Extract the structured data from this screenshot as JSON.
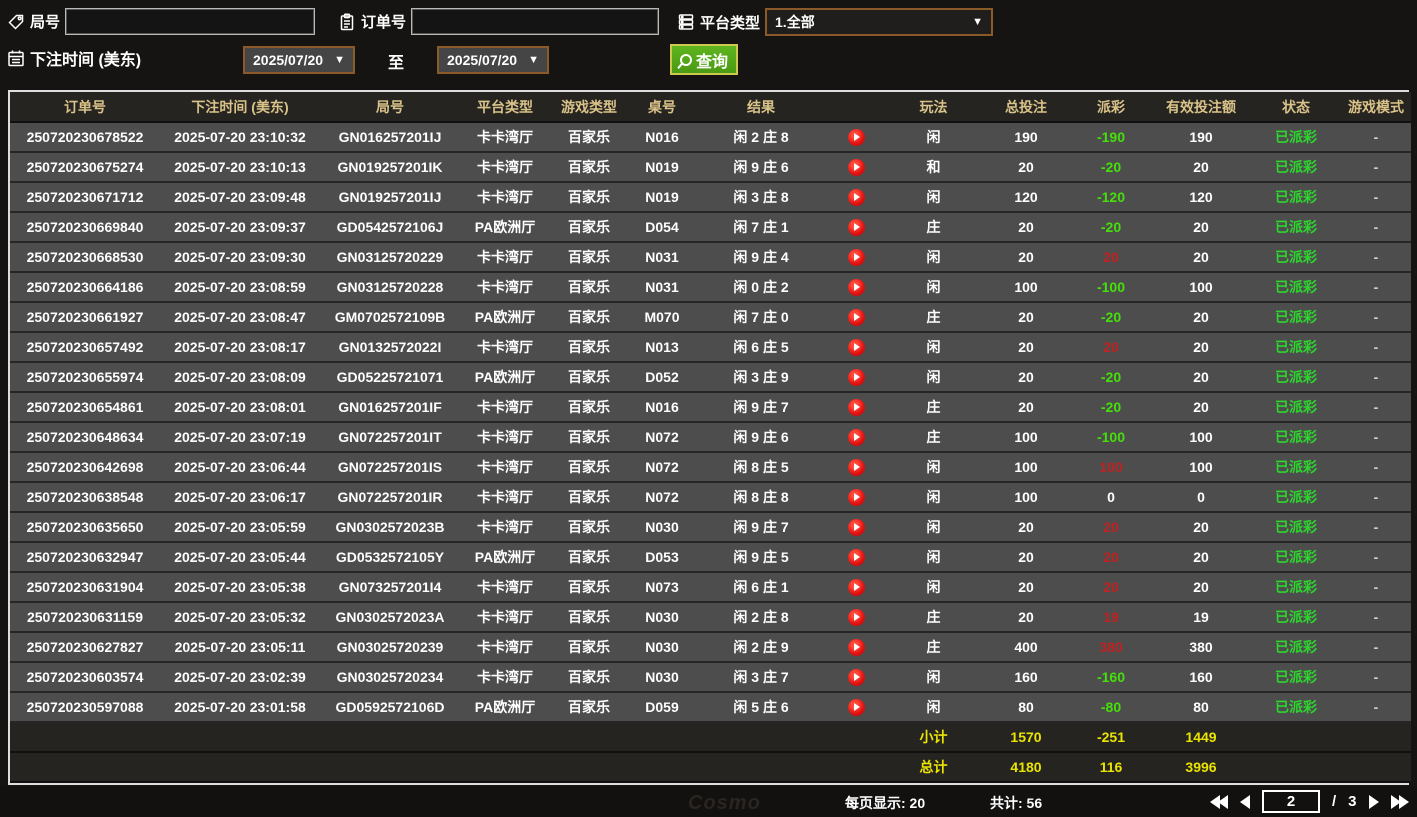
{
  "colors": {
    "header_text_gold": "#d9c389",
    "row_background": "#4d4d4d",
    "payout_loss_green": "#45e00a",
    "payout_win_red": "#bf2222",
    "status_paid_green": "#2dd52d",
    "totals_yellow": "#e9e400",
    "search_button_green": "#55a81c",
    "select_border_orange": "#8a5a28",
    "play_button_red": "#df1010"
  },
  "filters": {
    "round_label": "局号",
    "round_value": "",
    "order_label": "订单号",
    "order_value": "",
    "platform_label": "平台类型",
    "platform_value": "1.全部",
    "bet_time_label": "下注时间 (美东)",
    "date_from": "2025/07/20",
    "to_label": "至",
    "date_to": "2025/07/20",
    "search_label": "查询"
  },
  "table": {
    "headers": [
      {
        "key": "order-no",
        "label": "订单号"
      },
      {
        "key": "bet-time",
        "label": "下注时间 (美东)"
      },
      {
        "key": "round-no",
        "label": "局号"
      },
      {
        "key": "platform-type",
        "label": "平台类型"
      },
      {
        "key": "game-type",
        "label": "游戏类型"
      },
      {
        "key": "table-no",
        "label": "桌号"
      },
      {
        "key": "result",
        "label": "结果"
      },
      {
        "key": "video",
        "label": ""
      },
      {
        "key": "play-type",
        "label": "玩法"
      },
      {
        "key": "total-bet",
        "label": "总投注"
      },
      {
        "key": "payout",
        "label": "派彩"
      },
      {
        "key": "valid-bet",
        "label": "有效投注额"
      },
      {
        "key": "status",
        "label": "状态"
      },
      {
        "key": "game-mode",
        "label": "游戏模式"
      }
    ],
    "rows": [
      {
        "order": "250720230678522",
        "time": "2025-07-20 23:10:32",
        "round": "GN016257201IJ",
        "platform": "卡卡湾厅",
        "game": "百家乐",
        "table": "N016",
        "result": "闲 2 庄 8",
        "play": "闲",
        "bet": "190",
        "payout": "-190",
        "valid": "190",
        "status": "已派彩",
        "mode": "-"
      },
      {
        "order": "250720230675274",
        "time": "2025-07-20 23:10:13",
        "round": "GN019257201IK",
        "platform": "卡卡湾厅",
        "game": "百家乐",
        "table": "N019",
        "result": "闲 9 庄 6",
        "play": "和",
        "bet": "20",
        "payout": "-20",
        "valid": "20",
        "status": "已派彩",
        "mode": "-"
      },
      {
        "order": "250720230671712",
        "time": "2025-07-20 23:09:48",
        "round": "GN019257201IJ",
        "platform": "卡卡湾厅",
        "game": "百家乐",
        "table": "N019",
        "result": "闲 3 庄 8",
        "play": "闲",
        "bet": "120",
        "payout": "-120",
        "valid": "120",
        "status": "已派彩",
        "mode": "-"
      },
      {
        "order": "250720230669840",
        "time": "2025-07-20 23:09:37",
        "round": "GD0542572106J",
        "platform": "PA欧洲厅",
        "game": "百家乐",
        "table": "D054",
        "result": "闲 7 庄 1",
        "play": "庄",
        "bet": "20",
        "payout": "-20",
        "valid": "20",
        "status": "已派彩",
        "mode": "-"
      },
      {
        "order": "250720230668530",
        "time": "2025-07-20 23:09:30",
        "round": "GN03125720229",
        "platform": "卡卡湾厅",
        "game": "百家乐",
        "table": "N031",
        "result": "闲 9 庄 4",
        "play": "闲",
        "bet": "20",
        "payout": "20",
        "valid": "20",
        "status": "已派彩",
        "mode": "-"
      },
      {
        "order": "250720230664186",
        "time": "2025-07-20 23:08:59",
        "round": "GN03125720228",
        "platform": "卡卡湾厅",
        "game": "百家乐",
        "table": "N031",
        "result": "闲 0 庄 2",
        "play": "闲",
        "bet": "100",
        "payout": "-100",
        "valid": "100",
        "status": "已派彩",
        "mode": "-"
      },
      {
        "order": "250720230661927",
        "time": "2025-07-20 23:08:47",
        "round": "GM0702572109B",
        "platform": "PA欧洲厅",
        "game": "百家乐",
        "table": "M070",
        "result": "闲 7 庄 0",
        "play": "庄",
        "bet": "20",
        "payout": "-20",
        "valid": "20",
        "status": "已派彩",
        "mode": "-"
      },
      {
        "order": "250720230657492",
        "time": "2025-07-20 23:08:17",
        "round": "GN0132572022I",
        "platform": "卡卡湾厅",
        "game": "百家乐",
        "table": "N013",
        "result": "闲 6 庄 5",
        "play": "闲",
        "bet": "20",
        "payout": "20",
        "valid": "20",
        "status": "已派彩",
        "mode": "-"
      },
      {
        "order": "250720230655974",
        "time": "2025-07-20 23:08:09",
        "round": "GD05225721071",
        "platform": "PA欧洲厅",
        "game": "百家乐",
        "table": "D052",
        "result": "闲 3 庄 9",
        "play": "闲",
        "bet": "20",
        "payout": "-20",
        "valid": "20",
        "status": "已派彩",
        "mode": "-"
      },
      {
        "order": "250720230654861",
        "time": "2025-07-20 23:08:01",
        "round": "GN016257201IF",
        "platform": "卡卡湾厅",
        "game": "百家乐",
        "table": "N016",
        "result": "闲 9 庄 7",
        "play": "庄",
        "bet": "20",
        "payout": "-20",
        "valid": "20",
        "status": "已派彩",
        "mode": "-"
      },
      {
        "order": "250720230648634",
        "time": "2025-07-20 23:07:19",
        "round": "GN072257201IT",
        "platform": "卡卡湾厅",
        "game": "百家乐",
        "table": "N072",
        "result": "闲 9 庄 6",
        "play": "庄",
        "bet": "100",
        "payout": "-100",
        "valid": "100",
        "status": "已派彩",
        "mode": "-"
      },
      {
        "order": "250720230642698",
        "time": "2025-07-20 23:06:44",
        "round": "GN072257201IS",
        "platform": "卡卡湾厅",
        "game": "百家乐",
        "table": "N072",
        "result": "闲 8 庄 5",
        "play": "闲",
        "bet": "100",
        "payout": "100",
        "valid": "100",
        "status": "已派彩",
        "mode": "-"
      },
      {
        "order": "250720230638548",
        "time": "2025-07-20 23:06:17",
        "round": "GN072257201IR",
        "platform": "卡卡湾厅",
        "game": "百家乐",
        "table": "N072",
        "result": "闲 8 庄 8",
        "play": "闲",
        "bet": "100",
        "payout": "0",
        "valid": "0",
        "status": "已派彩",
        "mode": "-"
      },
      {
        "order": "250720230635650",
        "time": "2025-07-20 23:05:59",
        "round": "GN0302572023B",
        "platform": "卡卡湾厅",
        "game": "百家乐",
        "table": "N030",
        "result": "闲 9 庄 7",
        "play": "闲",
        "bet": "20",
        "payout": "20",
        "valid": "20",
        "status": "已派彩",
        "mode": "-"
      },
      {
        "order": "250720230632947",
        "time": "2025-07-20 23:05:44",
        "round": "GD0532572105Y",
        "platform": "PA欧洲厅",
        "game": "百家乐",
        "table": "D053",
        "result": "闲 9 庄 5",
        "play": "闲",
        "bet": "20",
        "payout": "20",
        "valid": "20",
        "status": "已派彩",
        "mode": "-"
      },
      {
        "order": "250720230631904",
        "time": "2025-07-20 23:05:38",
        "round": "GN073257201I4",
        "platform": "卡卡湾厅",
        "game": "百家乐",
        "table": "N073",
        "result": "闲 6 庄 1",
        "play": "闲",
        "bet": "20",
        "payout": "20",
        "valid": "20",
        "status": "已派彩",
        "mode": "-"
      },
      {
        "order": "250720230631159",
        "time": "2025-07-20 23:05:32",
        "round": "GN0302572023A",
        "platform": "卡卡湾厅",
        "game": "百家乐",
        "table": "N030",
        "result": "闲 2 庄 8",
        "play": "庄",
        "bet": "20",
        "payout": "19",
        "valid": "19",
        "status": "已派彩",
        "mode": "-"
      },
      {
        "order": "250720230627827",
        "time": "2025-07-20 23:05:11",
        "round": "GN03025720239",
        "platform": "卡卡湾厅",
        "game": "百家乐",
        "table": "N030",
        "result": "闲 2 庄 9",
        "play": "庄",
        "bet": "400",
        "payout": "380",
        "valid": "380",
        "status": "已派彩",
        "mode": "-"
      },
      {
        "order": "250720230603574",
        "time": "2025-07-20 23:02:39",
        "round": "GN03025720234",
        "platform": "卡卡湾厅",
        "game": "百家乐",
        "table": "N030",
        "result": "闲 3 庄 7",
        "play": "闲",
        "bet": "160",
        "payout": "-160",
        "valid": "160",
        "status": "已派彩",
        "mode": "-"
      },
      {
        "order": "250720230597088",
        "time": "2025-07-20 23:01:58",
        "round": "GD0592572106D",
        "platform": "PA欧洲厅",
        "game": "百家乐",
        "table": "D059",
        "result": "闲 5 庄 6",
        "play": "闲",
        "bet": "80",
        "payout": "-80",
        "valid": "80",
        "status": "已派彩",
        "mode": "-"
      }
    ],
    "subtotal": {
      "label": "小计",
      "bet": "1570",
      "payout": "-251",
      "valid": "1449"
    },
    "total": {
      "label": "总计",
      "bet": "4180",
      "payout": "116",
      "valid": "3996"
    }
  },
  "footer": {
    "page_size": "每页显示: 20",
    "total_count": "共计: 56",
    "current_page": "2",
    "page_separator": "/",
    "total_pages": "3"
  },
  "watermark": "Cosmo"
}
